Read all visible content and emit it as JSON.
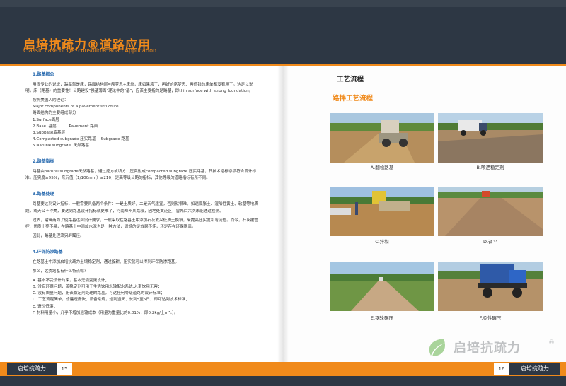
{
  "header": {
    "title": "启培抗疏力®道路应用",
    "subtitle": "Classic case of QP•consolid® Road Application"
  },
  "left": {
    "s1_title": "1.路基概念",
    "s1_p1": "用很专业的说说，路基就是床，路面结构层=席梦思+床单，床如果垮了，再好的席梦思、再值钱的床单都没有用了。这足以说明，床（路基）的重要性！公路建设\"强基薄面\"理论中的\"基\"，应该主要指的是路基，即thin surface with strong foundation。",
    "s1_list": [
      "按照美国人的理论：",
      "Major components of a pavement structure",
      "路面结构的主要组成部分",
      "1.Surface面层",
      "2.Base  基层          Pavement 路面",
      "3.Subbase底基层",
      "4.Compacted subgrade 压实路基    Subgrade 路基",
      "5.Natural subgrade  天然路基"
    ],
    "s2_title": "2.路基指标",
    "s2_p1": "路基由natural subgrade天然路基，通过挖方或填方、压实形成compacted subgrade 压实路基，其技术指标必须符合设计标准。压实度≥95%，弯沉值（1/100mm）≤210，是高等级公路的指标，其他等级的道路指标有所不同。",
    "s3_title": "3.路基处理",
    "s3_p1": "路基要达到设计指标，一般需要具备两个条件：一是土质好，二是天气适宜，否则就很难。如遇膨胀土、湿陷性黄土、软基等地质题，或天公不作美，要达到路基设计指标就更难了，河南郑州某路段，因地处黄泛区，曾先后六次未能通过检测。",
    "s3_p2": "过去，建筑商为了使路基达到设计要求，一般采取在路基土中添加石灰或采低质土换填，来提高压实度和弯沉值。而今，石灰被管控、优质土奖不易，在路基土中添加水泥也是一种方法，遗憾的是效果不佳，还是存在环保隐患。",
    "s3_p3": "因此，路基处理须另辟蹊径。",
    "s4_title": "4.环保防渗路基",
    "s4_p1": "在路基土中添加启培抗疏力土壤稳定剂，通过旋耕、压实就可以得到环保防渗路基。",
    "s4_p2": "那么，这类路基有什么特点呢？",
    "s4_list": [
      "A.  基本不受设计约束，基本无须变更设计；",
      "B.  没有环保问题，该稳定剂可用于生活饮用水输配水系统,入畜饮用无害；",
      "C.  没有质量问题，用该稳定剂处理的路基，可达任何等级道路的设计标准；",
      "D.  工艺流程简单，修建速度快、设备常规，短到当天、长到5至5日，即可达到技术标准；",
      "E.  造价低廉；",
      "F.  材料用量小，几乎不增加运输成本（用量为重量比的0.01%，即0.2kg/土m³。）。"
    ]
  },
  "right": {
    "title": "工艺流程",
    "subtitle": "路拌工艺流程",
    "captions": [
      "A.翻松路基",
      "B.喷洒稳定剂",
      "C.拌和",
      "D.调平",
      "E.钢轮碾压",
      "F.柔性碾压"
    ]
  },
  "footer": {
    "logo_text": "启培抗疏力",
    "page_left": "15",
    "page_right": "16"
  },
  "brand": {
    "name": "启培抗疏力",
    "reg": "®"
  },
  "colors": {
    "accent": "#f08a1b",
    "header_bg": "#2d3744",
    "section_title": "#2b6cb0"
  }
}
